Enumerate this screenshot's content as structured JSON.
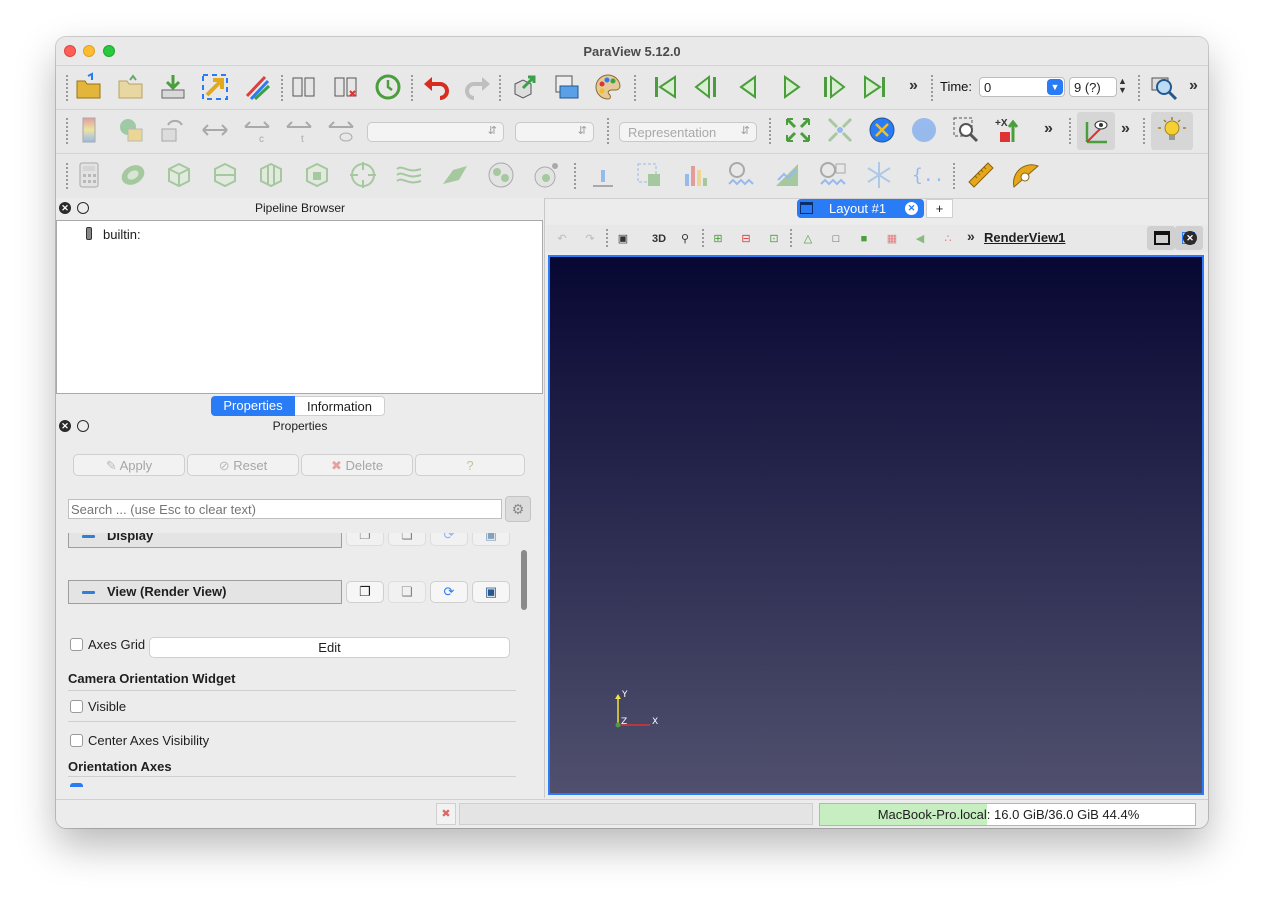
{
  "window": {
    "title": "ParaView 5.12.0"
  },
  "toolbar": {
    "time_label": "Time:",
    "time_value": "0",
    "timestep_value": "9 (?)",
    "combo1": "",
    "combo2": "",
    "representation": "Representation"
  },
  "pipeline": {
    "header": "Pipeline Browser",
    "root": "builtin:"
  },
  "panel_tabs": [
    {
      "label": "Properties",
      "active": true
    },
    {
      "label": "Information",
      "active": false
    }
  ],
  "properties": {
    "header": "Properties",
    "apply": "Apply",
    "reset": "Reset",
    "delete": "Delete",
    "help": "?",
    "search_placeholder": "Search ... (use Esc to clear text)",
    "section_display": "Display",
    "section_view": "View (Render View)",
    "axes_grid": "Axes Grid",
    "edit": "Edit",
    "camera_widget_title": "Camera Orientation Widget",
    "visible": "Visible",
    "center_axes": "Center Axes Visibility",
    "orientation_axes_title": "Orientation Axes"
  },
  "layout": {
    "tab": "Layout #1",
    "add": "+"
  },
  "view": {
    "mode_3d": "3D",
    "render_view_name": "RenderView1"
  },
  "axes": {
    "y": "Y",
    "z": "Z",
    "x": "X"
  },
  "status": {
    "memory": "MacBook-Pro.local: 16.0 GiB/36.0 GiB 44.4%",
    "memory_fraction": 0.444
  },
  "colors": {
    "accent": "#2a7bf6",
    "render_top": "#070733",
    "render_bottom": "#50506e"
  }
}
